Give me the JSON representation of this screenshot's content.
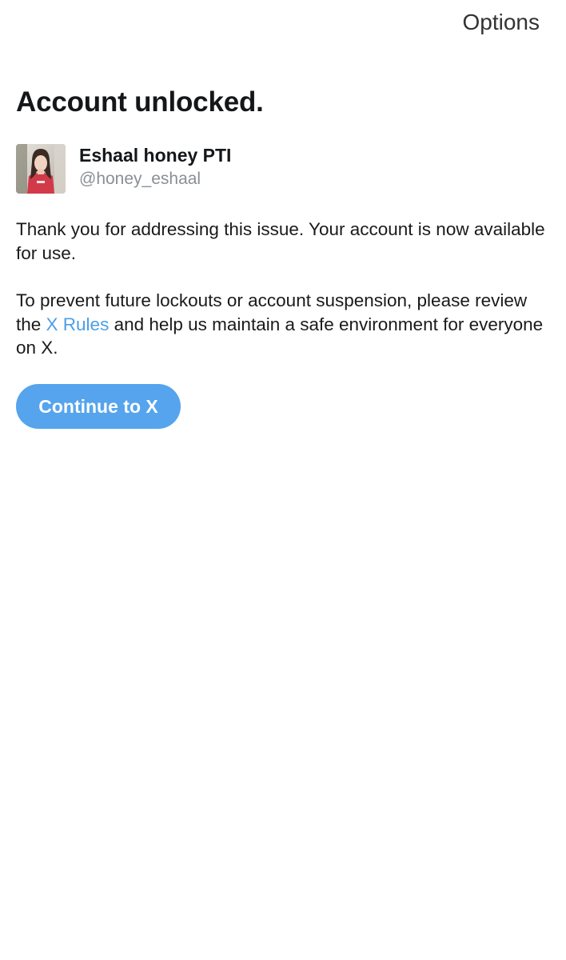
{
  "header": {
    "options_label": "Options"
  },
  "main": {
    "title": "Account unlocked.",
    "profile": {
      "display_name": "Eshaal honey PTI",
      "handle": "@honey_eshaal",
      "avatar_icon": "profile-photo"
    },
    "message_1": "Thank you for addressing this issue. Your account is now available for use.",
    "message_2": {
      "prefix": "To prevent future lockouts or account suspension, please review the ",
      "link_text": "X Rules",
      "suffix": " and help us maintain a safe environment for everyone on X."
    },
    "continue_button_label": "Continue to X"
  },
  "colors": {
    "link": "#4a9fe8",
    "button_background": "#55a4ed",
    "button_text": "#ffffff",
    "handle_text": "#8a8f94"
  }
}
